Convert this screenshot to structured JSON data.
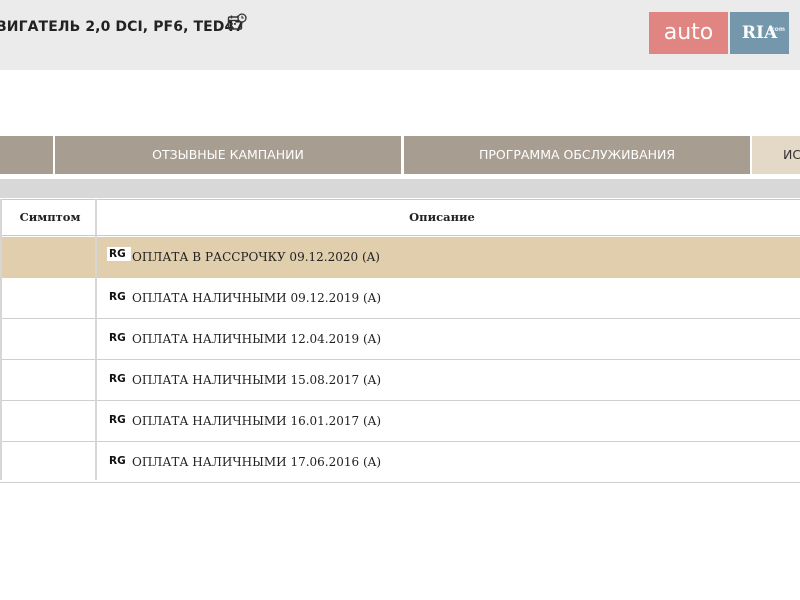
{
  "header": {
    "title": "ВИГАТЕЛЬ 2,0 DCI, PF6, TED47",
    "calendar_icon": "calendar-clock-icon"
  },
  "watermark": {
    "auto": "auto",
    "ria": "RIA",
    "com": ".com"
  },
  "tabs": [
    {
      "label": ""
    },
    {
      "label": "ОТЗЫВНЫЕ КАМПАНИИ"
    },
    {
      "label": "ПРОГРАММА ОБСЛУЖИВАНИЯ"
    },
    {
      "label": "ИС"
    }
  ],
  "table": {
    "columns": [
      "Симптом",
      "Описание"
    ],
    "rows": [
      {
        "badge": "RG",
        "text": "ОПЛАТА В РАССРОЧКУ 09.12.2020 (A)",
        "highlighted": true
      },
      {
        "badge": "RG",
        "text": "ОПЛАТА НАЛИЧНЫМИ 09.12.2019 (A)",
        "highlighted": false
      },
      {
        "badge": "RG",
        "text": "ОПЛАТА НАЛИЧНЫМИ 12.04.2019 (A)",
        "highlighted": false
      },
      {
        "badge": "RG",
        "text": "ОПЛАТА НАЛИЧНЫМИ 15.08.2017 (A)",
        "highlighted": false
      },
      {
        "badge": "RG",
        "text": "ОПЛАТА НАЛИЧНЫМИ 16.01.2017 (A)",
        "highlighted": false
      },
      {
        "badge": "RG",
        "text": "ОПЛАТА НАЛИЧНЫМИ 17.06.2016 (A)",
        "highlighted": false
      }
    ]
  },
  "colors": {
    "tab_bg": "#a89d91",
    "tab_active_bg": "#e4d8c6",
    "row_highlight": "#e0ceac",
    "header_bg": "#ebebeb"
  }
}
